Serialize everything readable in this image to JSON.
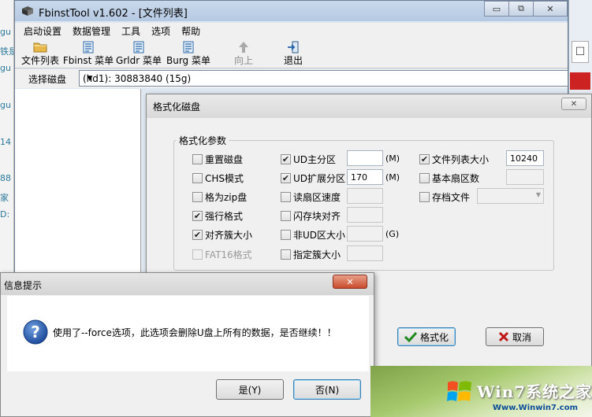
{
  "main_window": {
    "title": "FbinstTool v1.602 - [文件列表]",
    "controls": {
      "minimize": "▭",
      "maximize": "⧉",
      "close": "✕"
    }
  },
  "menu": [
    "启动设置",
    "数据管理",
    "工具",
    "选项",
    "帮助"
  ],
  "toolbar": [
    {
      "label": "文件列表",
      "icon": "folder-icon"
    },
    {
      "label": "Fbinst 菜单",
      "icon": "menu-doc-icon"
    },
    {
      "label": "Grldr 菜单",
      "icon": "menu-doc-icon"
    },
    {
      "label": "Burg 菜单",
      "icon": "menu-doc-icon"
    },
    {
      "label": "向上",
      "icon": "up-arrow-icon",
      "disabled": true
    },
    {
      "label": "退出",
      "icon": "exit-icon"
    }
  ],
  "disk": {
    "label": "选择磁盘",
    "selected": "(hd1): 30883840 (15g)"
  },
  "format_dialog": {
    "title": "格式化磁盘",
    "close": "✕",
    "group_title": "格式化参数",
    "col1": [
      {
        "label": "重置磁盘",
        "checked": false
      },
      {
        "label": "CHS模式",
        "checked": false
      },
      {
        "label": "格为zip盘",
        "checked": false
      },
      {
        "label": "强行格式",
        "checked": true
      },
      {
        "label": "对齐簇大小",
        "checked": true
      },
      {
        "label": "FAT16格式",
        "checked": false,
        "disabled": true
      }
    ],
    "col2": [
      {
        "label": "UD主分区",
        "checked": true,
        "value": "",
        "unit": "(M)"
      },
      {
        "label": "UD扩展分区",
        "checked": true,
        "value": "170",
        "unit": "(M)"
      },
      {
        "label": "读扇区速度",
        "checked": false
      },
      {
        "label": "闪存块对齐",
        "checked": false
      },
      {
        "label": "非UD区大小",
        "checked": false,
        "unit": "(G)"
      },
      {
        "label": "指定簇大小",
        "checked": false
      }
    ],
    "col3": [
      {
        "label": "文件列表大小",
        "checked": true,
        "value": "10240"
      },
      {
        "label": "基本扇区数",
        "checked": false
      },
      {
        "label": "存档文件",
        "checked": false
      }
    ],
    "ok_label": "格式化",
    "cancel_label": "取消"
  },
  "info_dialog": {
    "title": "信息提示",
    "close": "✕",
    "message": "使用了--force选项，此选项会删除U盘上所有的数据，是否继续！！",
    "yes_label": "是(Y)",
    "no_label": "否(N)"
  },
  "watermark": {
    "title": "Win7系统之家",
    "url": "Www.Winwin7.com"
  },
  "background": {
    "left_fragments": [
      "gu",
      "铁是",
      "gu",
      "gu",
      "14",
      "88",
      "家",
      "D:"
    ],
    "right_button": "☐"
  }
}
